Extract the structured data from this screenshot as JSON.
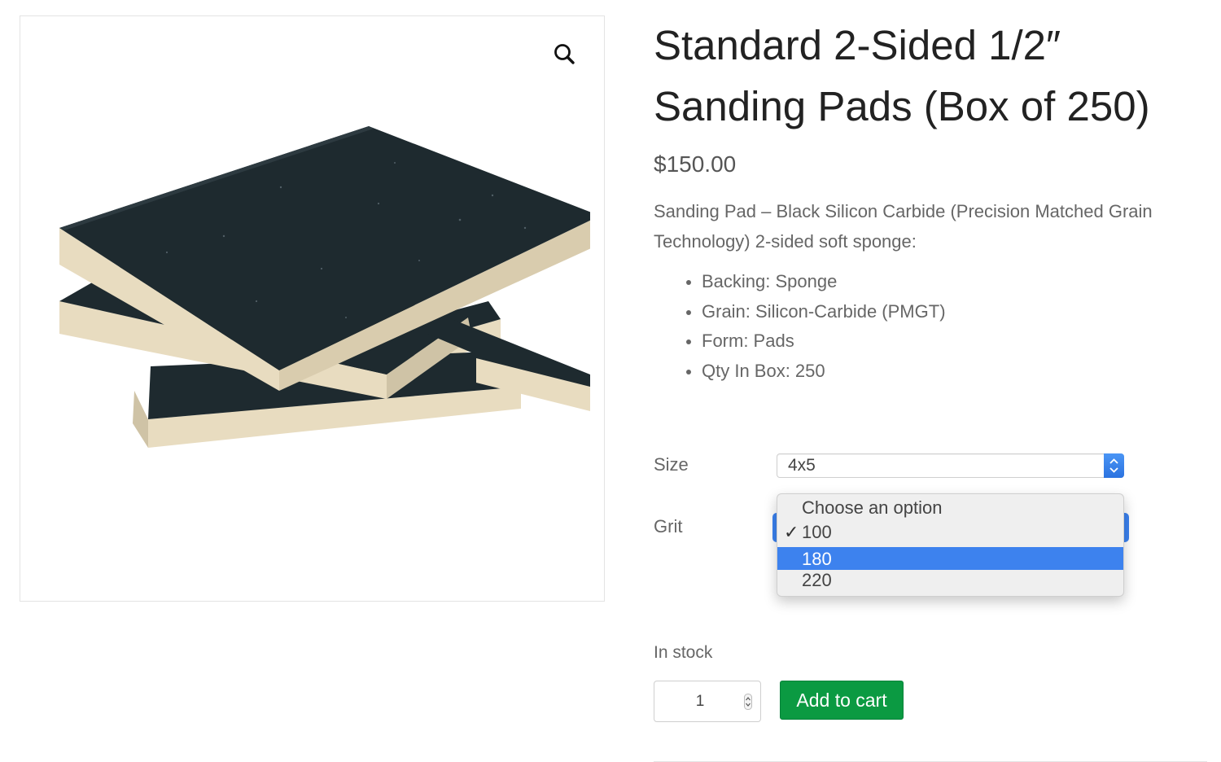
{
  "product": {
    "title": "Standard 2-Sided 1/2″ Sanding Pads (Box of 250)",
    "price": "$150.00",
    "description": "Sanding Pad – Black Silicon Carbide (Precision Matched Grain Technology) 2-sided soft sponge:",
    "specs": [
      "Backing: Sponge",
      "Grain: Silicon-Carbide (PMGT)",
      "Form: Pads",
      "Qty In Box: 250"
    ],
    "stock_status": "In stock",
    "image_icon": "sanding-pads-product-image"
  },
  "gallery": {
    "zoom_icon": "magnifier-icon"
  },
  "variations": {
    "size_label": "Size",
    "size_value": "4x5",
    "grit_label": "Grit",
    "grit_dropdown": {
      "options": [
        {
          "label": "Choose an option",
          "checked": false,
          "highlighted": false
        },
        {
          "label": "100",
          "checked": true,
          "highlighted": false
        },
        {
          "label": "180",
          "checked": false,
          "highlighted": true
        },
        {
          "label": "220",
          "checked": false,
          "highlighted": false
        }
      ],
      "check_mark": "✓"
    }
  },
  "cart": {
    "quantity": "1",
    "add_to_cart_label": "Add to cart"
  },
  "colors": {
    "add_to_cart": "#0b9a42",
    "highlight": "#3d82ee"
  }
}
